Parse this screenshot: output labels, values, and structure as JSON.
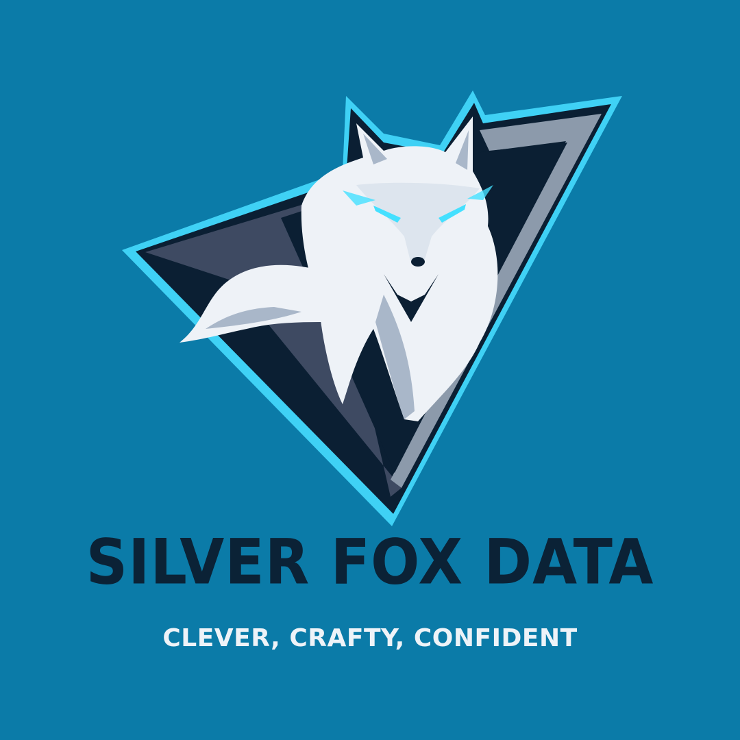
{
  "colors": {
    "background": "#0b7ba8",
    "outline_glow": "#3fd1f5",
    "shield_dark": "#0b1f33",
    "shield_bevel_light": "#8c9aab",
    "shield_bevel_dark": "#3e4a62",
    "fox_white": "#eef2f7",
    "fox_shade": "#a9b7c9",
    "eye_glow": "#44e0ff",
    "brand_text": "#0b2236",
    "tagline_text": "#eef3f8"
  },
  "logo": {
    "emblem_icon": "fox-in-triangle-shield-icon"
  },
  "brand": {
    "name": "SILVER FOX DATA",
    "tagline": "CLEVER, CRAFTY, CONFIDENT"
  }
}
